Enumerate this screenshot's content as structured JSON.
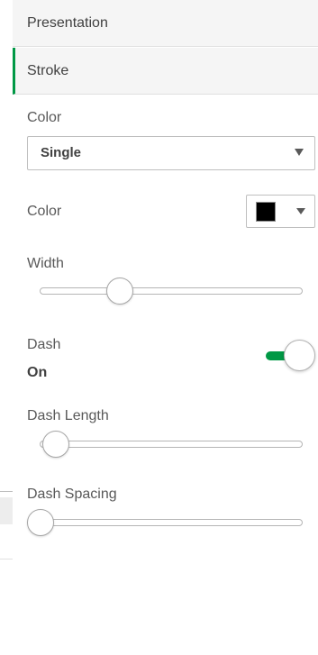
{
  "sections": {
    "presentation_label": "Presentation",
    "stroke_label": "Stroke"
  },
  "color_mode": {
    "label": "Color",
    "selected": "Single"
  },
  "color_picker": {
    "label": "Color",
    "value": "#000000"
  },
  "width": {
    "label": "Width",
    "value_fraction": 0.32
  },
  "dash": {
    "label": "Dash",
    "state": "On",
    "enabled": true
  },
  "dash_length": {
    "label": "Dash Length",
    "value_fraction": 0.06
  },
  "dash_spacing": {
    "label": "Dash Spacing",
    "value_fraction": 0.0
  },
  "colors": {
    "accent": "#009845",
    "header_bg": "#f5f5f5"
  }
}
